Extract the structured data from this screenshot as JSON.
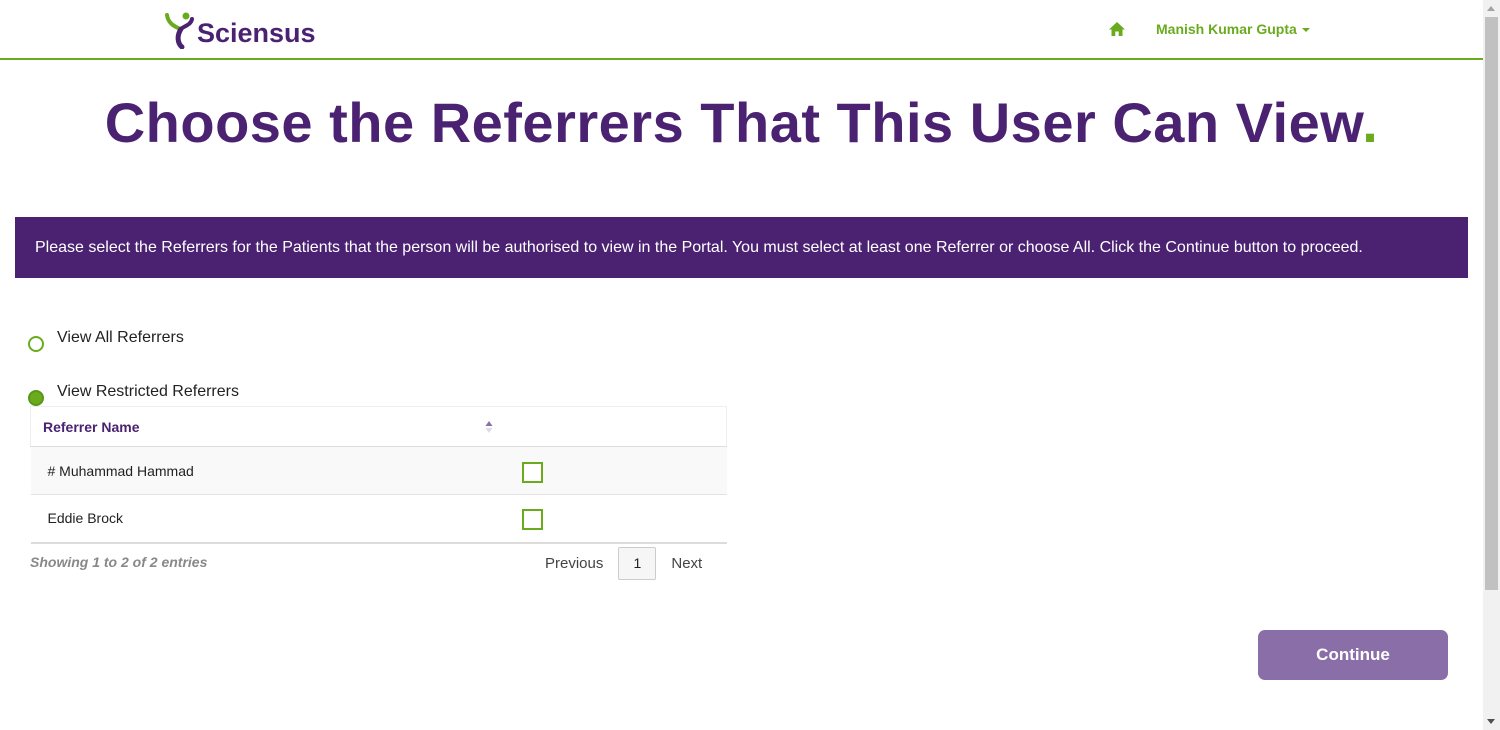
{
  "header": {
    "logo_text": "Sciensus",
    "home_icon": "home-icon",
    "user_name": "Manish Kumar Gupta"
  },
  "title": {
    "text": "Choose the Referrers That This User Can View",
    "dot": "."
  },
  "banner": {
    "text": "Please select the Referrers for the Patients that the person will be authorised to view in the Portal. You must select at least one Referrer or choose All. Click the Continue button to proceed."
  },
  "options": {
    "all_label": "View All Referrers",
    "restricted_label": "View Restricted Referrers",
    "selected": "restricted"
  },
  "table": {
    "column_name": "Referrer Name",
    "rows": [
      {
        "name": "# Muhammad Hammad",
        "checked": false
      },
      {
        "name": "Eddie Brock",
        "checked": false
      }
    ],
    "info": "Showing 1 to 2 of 2 entries",
    "pagination": {
      "previous": "Previous",
      "page": "1",
      "next": "Next"
    }
  },
  "continue_label": "Continue",
  "colors": {
    "brand_purple": "#4b2271",
    "brand_green": "#6aab1e",
    "button": "#8a6ea8"
  }
}
